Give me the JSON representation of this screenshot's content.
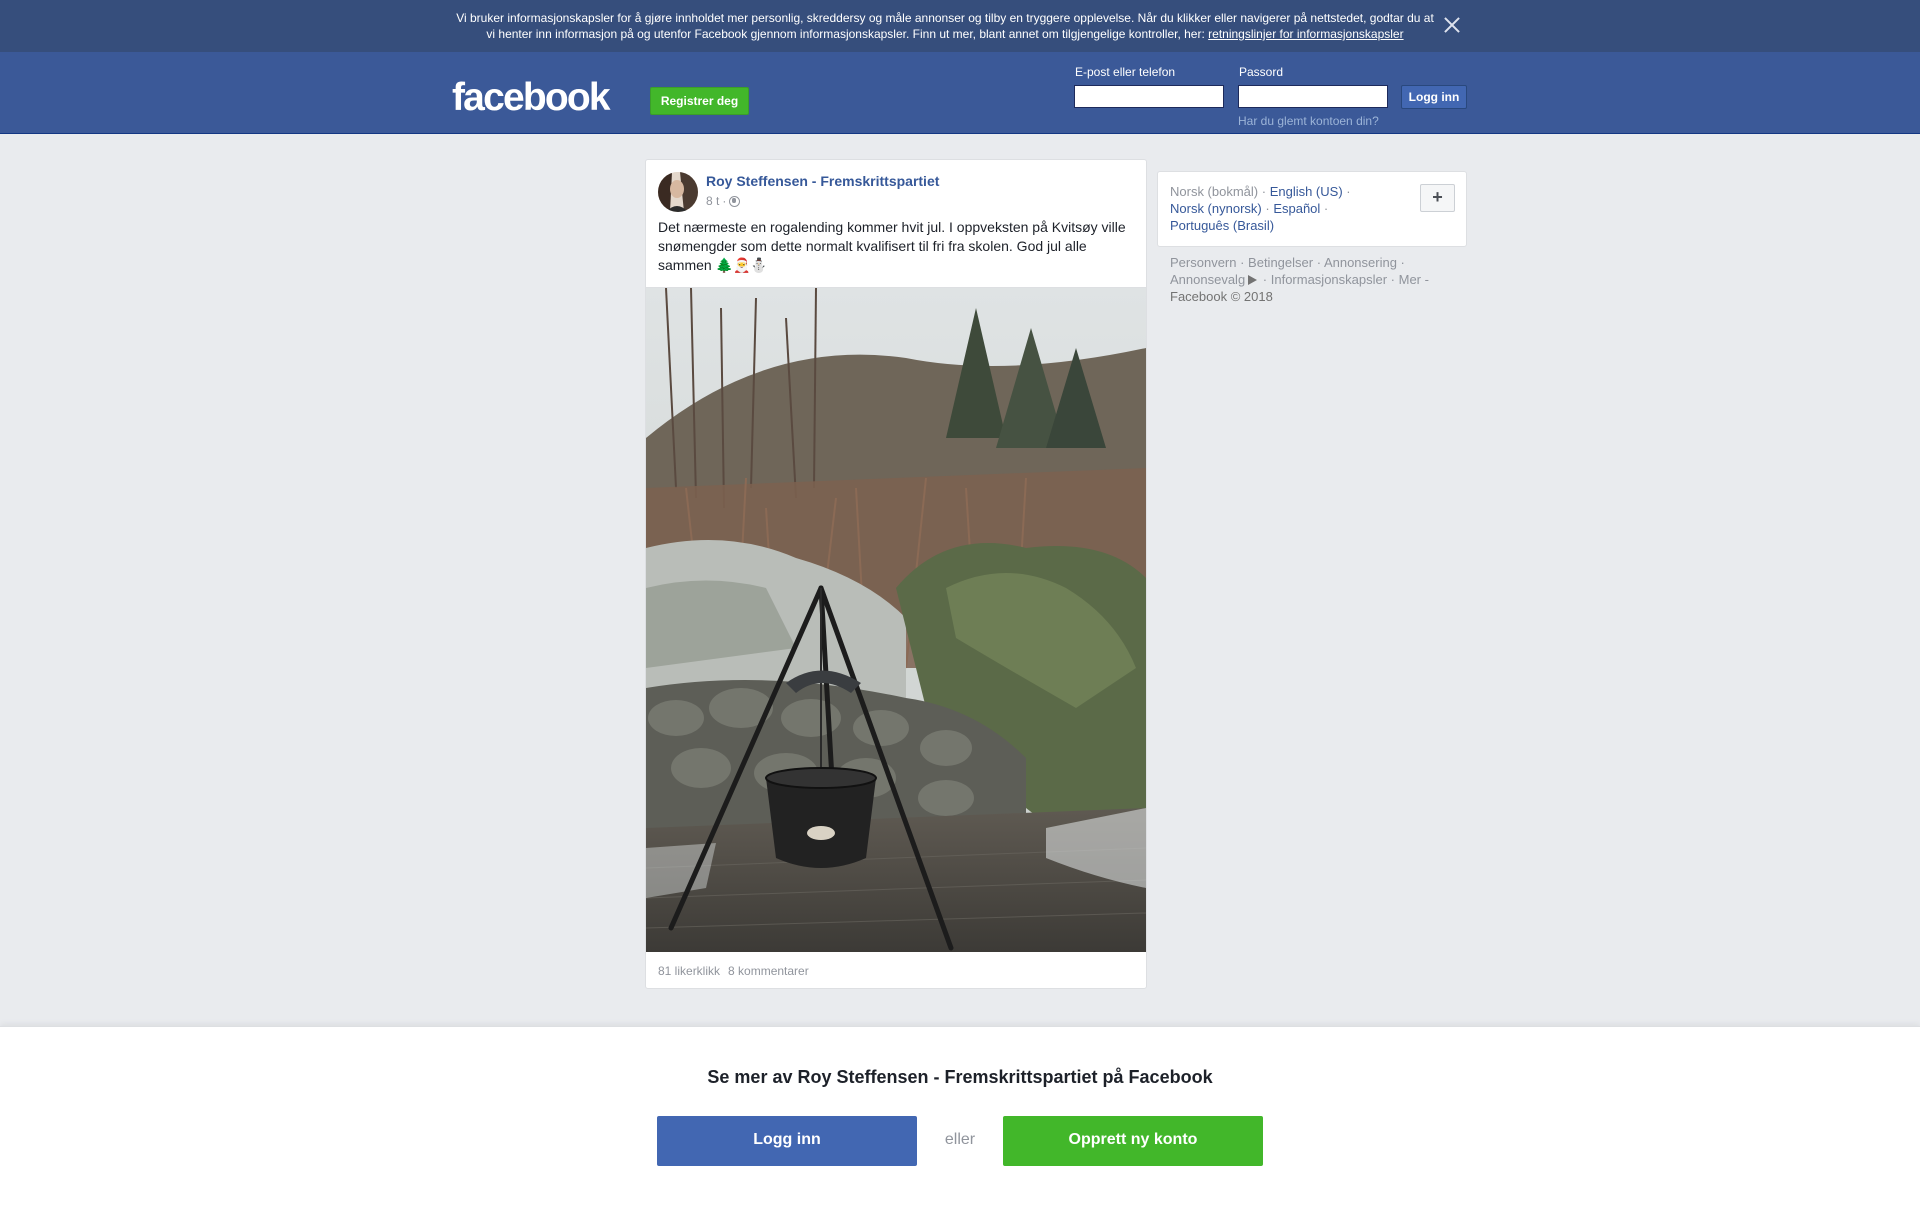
{
  "cookie_banner": {
    "text": "Vi bruker informasjonskapsler for å gjøre innholdet mer personlig, skreddersy og måle annonser og tilby en tryggere opplevelse. Når du klikker eller navigerer på nettstedet, godtar du at vi henter inn informasjon på og utenfor Facebook gjennom informasjonskapsler. Finn ut mer, blant annet om tilgjengelige kontroller, her: ",
    "link": "retningslinjer for informasjonskapsler",
    "close_icon": "close-icon"
  },
  "header": {
    "logo": "facebook",
    "register_label": "Registrer deg",
    "email_label": "E-post eller telefon",
    "email_value": "",
    "password_label": "Passord",
    "password_value": "",
    "login_label": "Logg inn",
    "forgot": "Har du glemt kontoen din?",
    "colors": {
      "bar": "#3b5998",
      "register": "#42b72a",
      "login": "#4267b2"
    }
  },
  "post": {
    "author": "Roy Steffensen - Fremskrittspartiet",
    "time": "8 t",
    "separator": "·",
    "privacy_icon": "globe-icon",
    "text": "Det nærmeste en rogalending kommer hvit jul. I oppveksten på Kvitsøy ville snømengder som dette normalt kvalifisert til fri fra skolen. God jul alle sammen 🌲🎅⛄",
    "likes": "81 likerklikk",
    "comments": "8 kommentarer"
  },
  "languages": {
    "current": "Norsk (bokmål)",
    "items": [
      "English (US)",
      "Norsk (nynorsk)",
      "Español",
      "Português (Brasil)"
    ],
    "sep": " · ",
    "more_button": "+"
  },
  "footer": {
    "links": [
      "Personvern",
      "Betingelser",
      "Annonsering",
      "Annonsevalg",
      "Informasjonskapsler",
      "Mer"
    ],
    "more_suffix": " -",
    "copyright": "Facebook © 2018"
  },
  "bottom": {
    "title": "Se mer av Roy Steffensen - Fremskrittspartiet på Facebook",
    "login_label": "Logg inn",
    "or": "eller",
    "create_label": "Opprett ny konto"
  }
}
